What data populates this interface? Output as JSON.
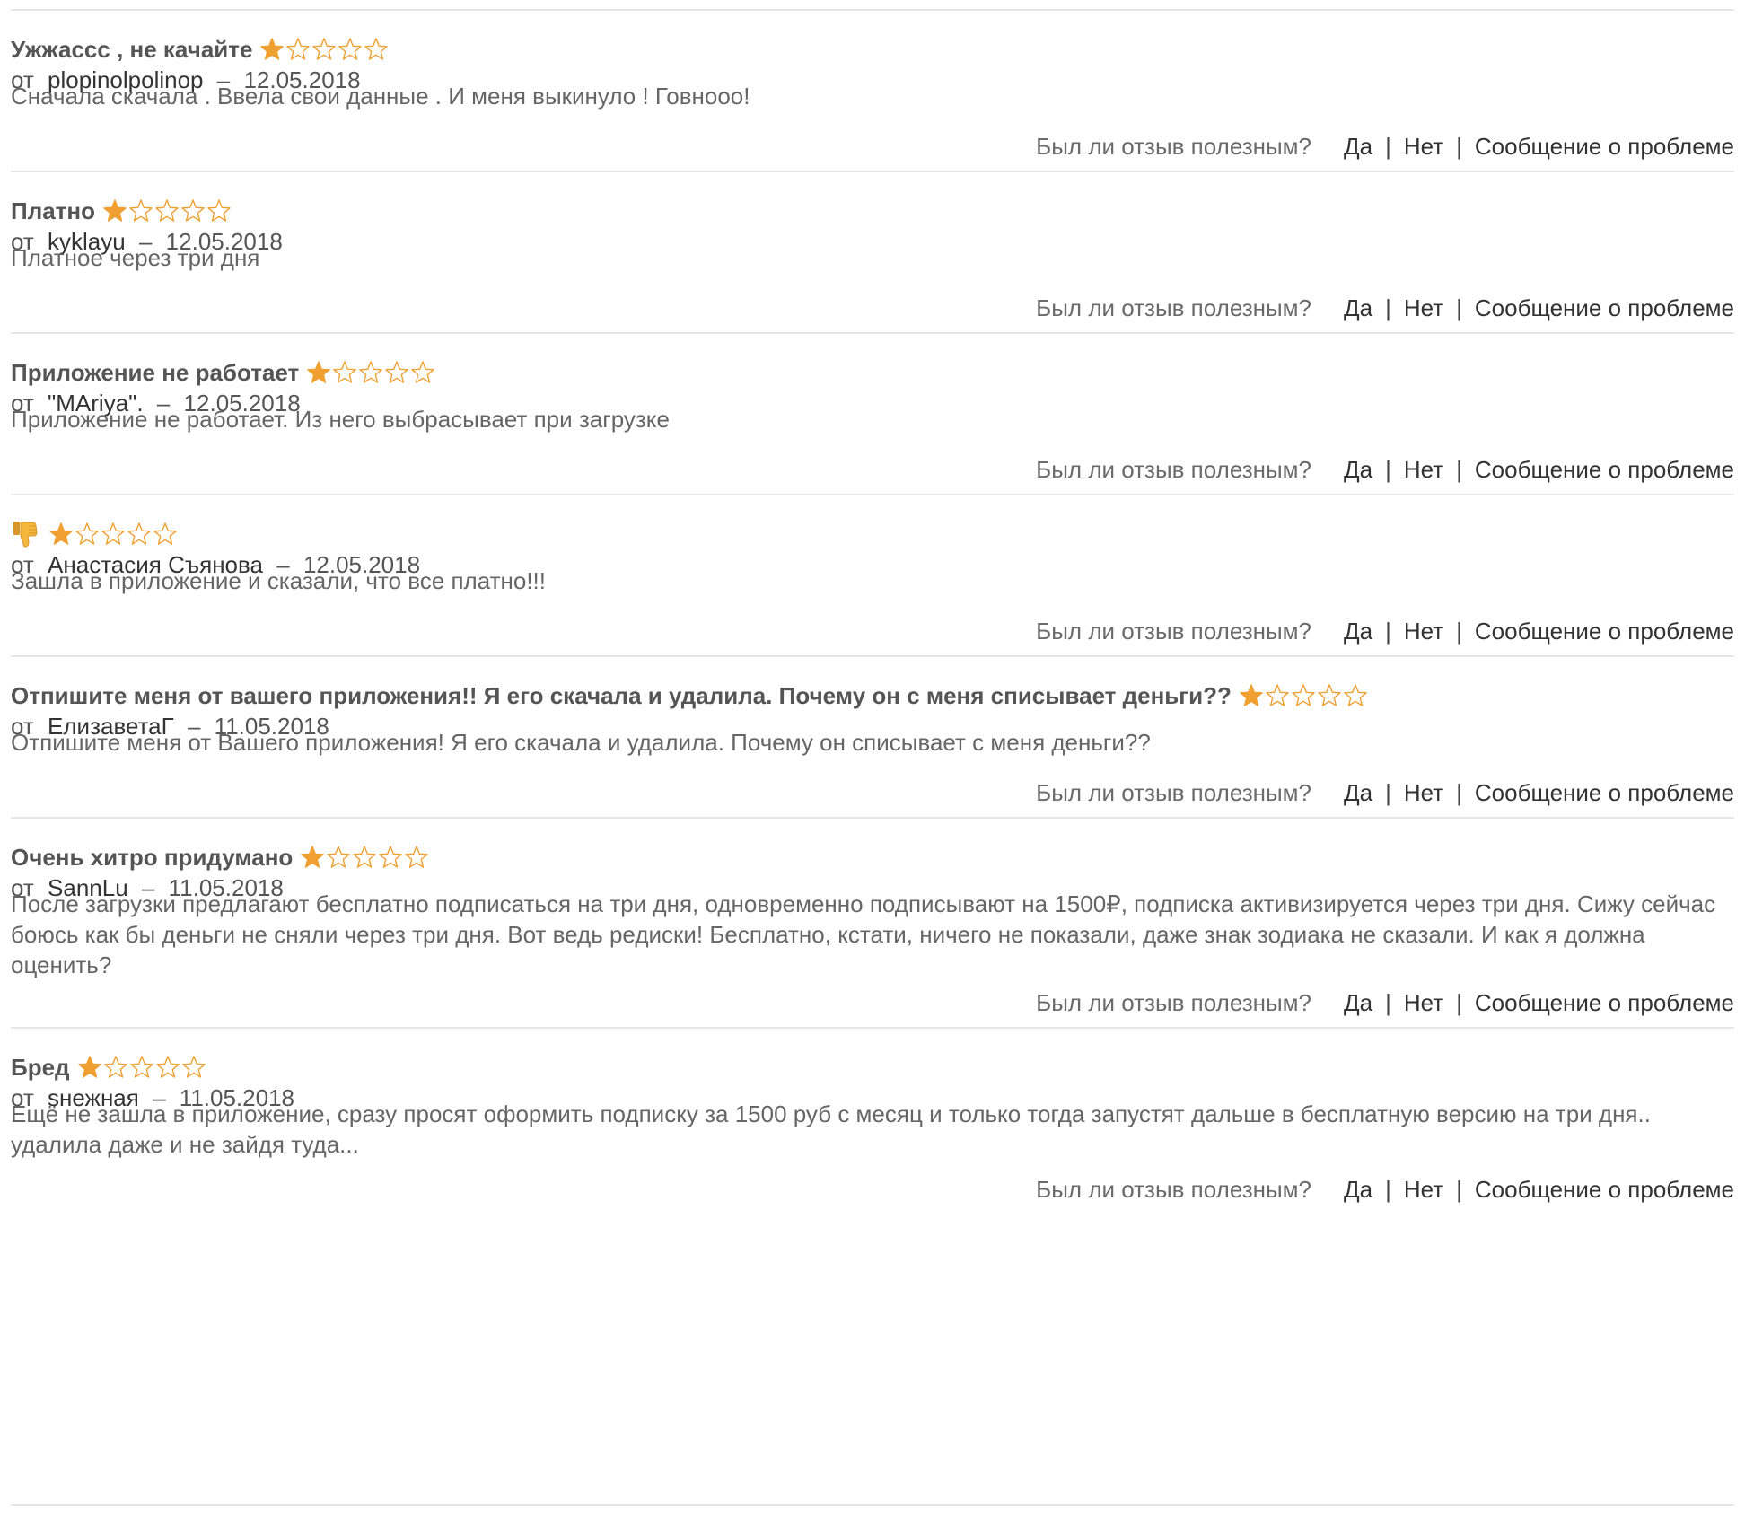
{
  "feedback": {
    "question": "Был ли отзыв полезным?",
    "yes": "Да",
    "no": "Нет",
    "separator": "|",
    "report": "Сообщение о проблеме"
  },
  "author_prefix": "от",
  "date_separator": "–",
  "star_color": "#f0a030",
  "reviews": [
    {
      "title": "Ужжассс , не качайте",
      "rating": 1,
      "author": "plopinolpolinop",
      "date": "12.05.2018",
      "body": "Сначала скачала . Ввела свои данные . И меня выкинуло ! Говнооо!"
    },
    {
      "title": "Платно",
      "rating": 1,
      "author": "kyklayu",
      "date": "12.05.2018",
      "body": "Платное через три дня"
    },
    {
      "title": "Приложение не работает",
      "rating": 1,
      "author": "\"MAriya\".",
      "date": "12.05.2018",
      "body": "Приложение не работает. Из него выбрасывает при загрузке"
    },
    {
      "title": "",
      "title_icon": "thumbs-down-icon",
      "rating": 1,
      "author": "Анастасия Съянова",
      "date": "12.05.2018",
      "body": "Зашла в приложение и сказали, что все платно!!!"
    },
    {
      "title": "Отпишите меня от вашего приложения!! Я его скачала и удалила. Почему он с меня списывает деньги??",
      "rating": 1,
      "author": "ЕлизаветаГ",
      "date": "11.05.2018",
      "body": "Отпишите меня от Вашего приложения! Я его скачала и удалила. Почему он списывает с меня деньги??"
    },
    {
      "title": "Очень хитро придумано",
      "rating": 1,
      "author": "SannLu",
      "date": "11.05.2018",
      "body": "После загрузки предлагают бесплатно подписаться на три дня, одновременно подписывают на 1500₽, подписка активизируется через три дня. Сижу сейчас боюсь как бы деньги не сняли через три дня. Вот ведь редиски! Бесплатно, кстати, ничего не показали, даже знак зодиака не сказали. И как я должна оценить?"
    },
    {
      "title": "Бред",
      "rating": 1,
      "author": "sнежная",
      "date": "11.05.2018",
      "body": "Ещё не зашла в приложение, сразу просят оформить подписку за 1500 руб с месяц и только тогда запустят дальше в бесплатную версию на три дня.. удалила даже и не зайдя туда..."
    }
  ]
}
